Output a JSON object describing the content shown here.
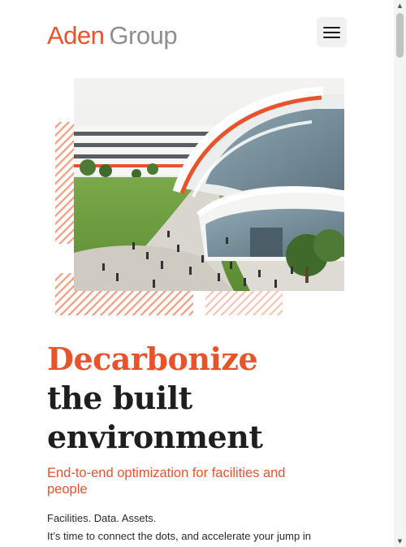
{
  "header": {
    "logo_primary": "Aden",
    "logo_secondary": "Group",
    "menu_button_icon": "hamburger-icon"
  },
  "hero": {
    "image_subject": "modern building with curved white and orange roof, lawn, people walking"
  },
  "headline": {
    "line1": "Decarbonize",
    "line2": "the built",
    "line3": "environment"
  },
  "subheadline": "End-to-end optimization for facilities and people",
  "tagline": "Facilities. Data. Assets.",
  "body_text": "It’s time to connect the dots, and accelerate your jump in",
  "colors": {
    "brand_orange": "#e8532c",
    "logo_grey": "#8f8f8f",
    "text_dark": "#1e1e1e"
  },
  "scrollbar": {
    "up_arrow": "▲",
    "down_arrow": "▼"
  }
}
